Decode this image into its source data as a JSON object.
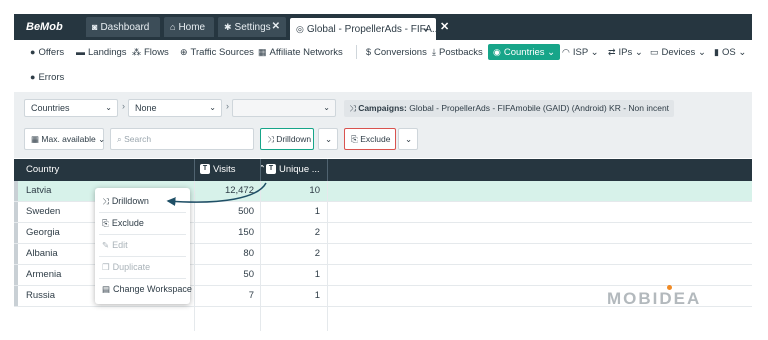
{
  "app": {
    "logo": "BeMob"
  },
  "tabs": [
    {
      "icon": "◙",
      "label": "Dashboard"
    },
    {
      "icon": "⌂",
      "label": "Home"
    },
    {
      "icon": "✱",
      "label": "Settings",
      "close": "✕"
    },
    {
      "icon": "◎",
      "label": "Global - PropellerAds - FIFA...",
      "dropdown": "⌄"
    }
  ],
  "tab_close_all": "✕",
  "nav": [
    {
      "icon": "●",
      "label": "Offers"
    },
    {
      "icon": "▬",
      "label": "Landings"
    },
    {
      "icon": "⁂",
      "label": "Flows"
    },
    {
      "icon": "⊕",
      "label": "Traffic Sources"
    },
    {
      "icon": "▦",
      "label": "Affiliate Networks"
    },
    {
      "icon": "$",
      "label": "Conversions"
    },
    {
      "icon": "⤓",
      "label": "Postbacks"
    },
    {
      "icon": "◉",
      "label": "Countries ⌄"
    },
    {
      "icon": "◠",
      "label": "ISP ⌄"
    },
    {
      "icon": "⇄",
      "label": "IPs ⌄"
    },
    {
      "icon": "▭",
      "label": "Devices ⌄"
    },
    {
      "icon": "▮",
      "label": "OS ⌄"
    }
  ],
  "nav2": [
    {
      "icon": "●",
      "label": "Errors"
    }
  ],
  "filters": {
    "group1": "Countries",
    "group2": "None",
    "group3": "",
    "campaign_prefix": "Campaigns:",
    "campaign_value": "Global - PropellerAds - FIFAmobile (GAID) (Android) KR - Non incent"
  },
  "toolbar": {
    "date_range": "Max. available",
    "search_placeholder": "Search",
    "drilldown": "Drilldown",
    "exclude": "Exclude"
  },
  "table": {
    "columns": [
      "Country",
      "Visits",
      "Unique ..."
    ],
    "rows": [
      {
        "country": "Latvia",
        "visits": "12,472",
        "unique": "10"
      },
      {
        "country": "Sweden",
        "visits": "500",
        "unique": "1"
      },
      {
        "country": "Georgia",
        "visits": "150",
        "unique": "2"
      },
      {
        "country": "Albania",
        "visits": "80",
        "unique": "2"
      },
      {
        "country": "Armenia",
        "visits": "50",
        "unique": "1"
      },
      {
        "country": "Russia",
        "visits": "7",
        "unique": "1"
      }
    ]
  },
  "context_menu": [
    {
      "icon": "⤨",
      "label": "Drilldown",
      "enabled": true
    },
    {
      "icon": "⎘",
      "label": "Exclude",
      "enabled": true
    },
    {
      "icon": "✎",
      "label": "Edit",
      "enabled": false
    },
    {
      "icon": "❐",
      "label": "Duplicate",
      "enabled": false
    },
    {
      "icon": "▤",
      "label": "Change Workspace",
      "enabled": true
    }
  ],
  "watermark": "MOBIDEA",
  "colors": {
    "topbar": "#263640",
    "accent": "#17a589",
    "highlight": "#d7f2ea",
    "exclude": "#d9534f"
  }
}
